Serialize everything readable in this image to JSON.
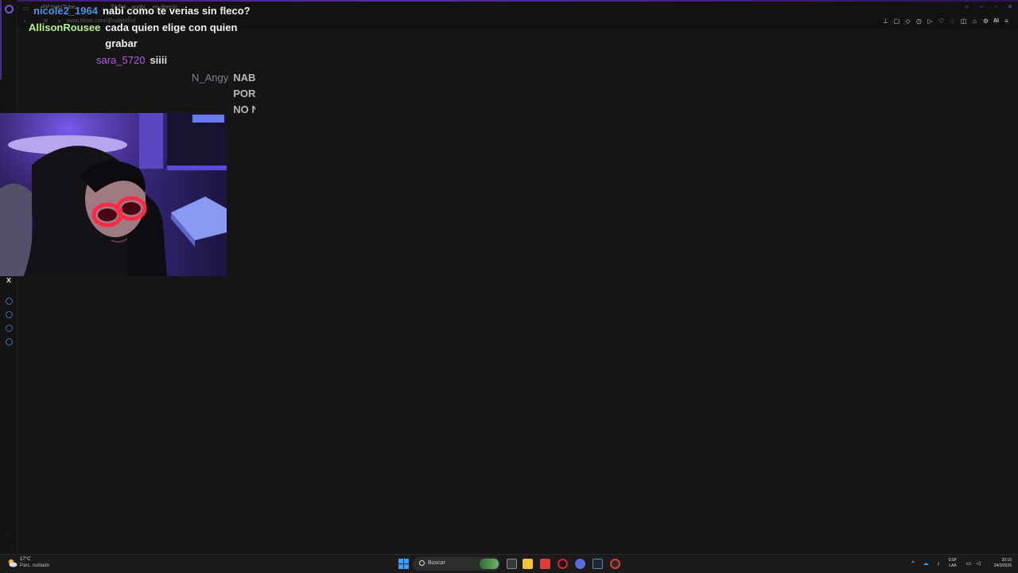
{
  "browser": {
    "tab_faint_1": "PP Nab/Tube",
    "tab_faint_2": "TikTok · anobi ... en directo",
    "url_faint": "www.tiktok.com/@nabirelnd",
    "toolbar_ai_label": "AI"
  },
  "chat": [
    {
      "user": "nicole2_1964",
      "message": "nabi como te verias sin fleco?",
      "user_color": "#4f8fe0"
    },
    {
      "user": "AllisonRousee",
      "message_lines": [
        "cada quien elige con quien",
        "grabar"
      ],
      "user_color": "#b7ef8a"
    },
    {
      "user": "sara_5720",
      "message": "siiii",
      "user_color": "#b45ae0"
    },
    {
      "user": "N_Angy",
      "message_lines": [
        "NAB",
        "POR",
        "NO N"
      ],
      "user_color": "#7a8290"
    }
  ],
  "sidebar": {
    "close_label": "x"
  },
  "taskbar": {
    "weather_temp": "17°C",
    "weather_desc": "Parc. nublado",
    "search_label": "Buscar",
    "lang_line1": "ESP",
    "lang_line2": "LAA",
    "time": "20:15",
    "date": "24/3/2026"
  },
  "icons": [
    "opera-logo-icon",
    "back-icon",
    "forward-icon",
    "reload-icon",
    "bookmark-icon",
    "shield-icon",
    "play-icon",
    "heart-icon",
    "chat-icon",
    "share-icon",
    "settings-icon",
    "menu-icon",
    "windows-start-icon",
    "search-icon",
    "file-explorer-icon",
    "opera-icon",
    "steam-icon",
    "wifi-icon",
    "volume-icon",
    "battery-icon"
  ]
}
